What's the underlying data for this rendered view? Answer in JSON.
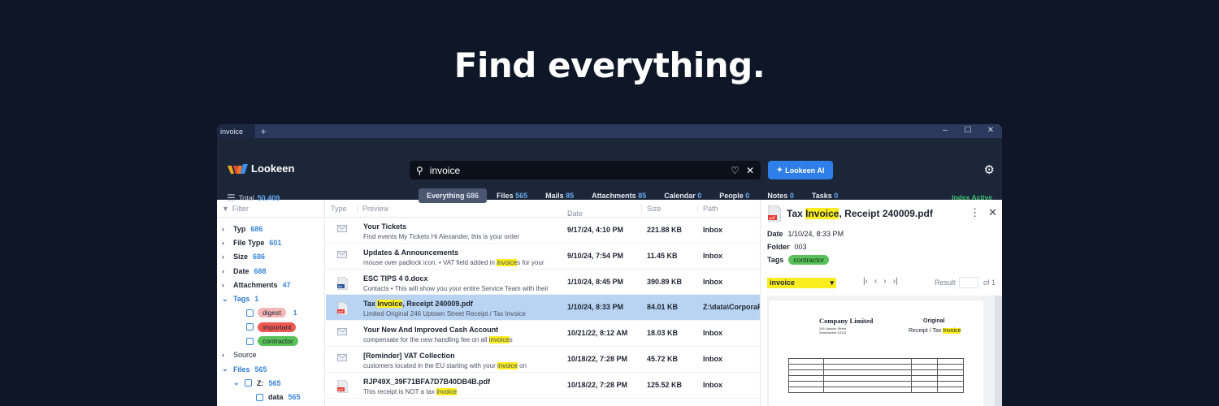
{
  "headline": "Find everything.",
  "window": {
    "tab_label": "invoice",
    "tab_add": "+",
    "controls": {
      "minimize": "–",
      "maximize": "☐",
      "close": "✕"
    }
  },
  "app": {
    "name": "Lookeen",
    "search": {
      "value": "invoice",
      "placeholder": ""
    },
    "ai_button": "Lookeen AI",
    "total_label": "Total",
    "total_count": "50,409",
    "index_status": "Index Active",
    "tabs": [
      {
        "label": "Everything",
        "count": "686"
      },
      {
        "label": "Files",
        "count": "565"
      },
      {
        "label": "Mails",
        "count": "85"
      },
      {
        "label": "Attachments",
        "count": "85"
      },
      {
        "label": "Calendar",
        "count": "0"
      },
      {
        "label": "People",
        "count": "0"
      },
      {
        "label": "Notes",
        "count": "0"
      },
      {
        "label": "Tasks",
        "count": "0"
      }
    ]
  },
  "filter": {
    "header": "Filter",
    "items": [
      {
        "label": "Typ",
        "count": "686"
      },
      {
        "label": "File Type",
        "count": "601"
      },
      {
        "label": "Size",
        "count": "686"
      },
      {
        "label": "Date",
        "count": "688"
      },
      {
        "label": "Attachments",
        "count": "47"
      }
    ],
    "tags": {
      "label": "Tags",
      "count": "1"
    },
    "tag_items": [
      {
        "label": "digest",
        "count": "1",
        "color": "#f4b6b6"
      },
      {
        "label": "important",
        "count": "",
        "color": "#ee5a52"
      },
      {
        "label": "contractor",
        "count": "",
        "color": "#5ac25a"
      }
    ],
    "source": "Source",
    "files": {
      "label": "Files",
      "count": "565"
    },
    "drive": {
      "label": "Z:",
      "count": "565"
    },
    "data_folder": {
      "label": "data",
      "count": "565"
    }
  },
  "list": {
    "columns": {
      "type": "Type",
      "preview": "Preview",
      "date": "Date",
      "size": "Size",
      "path": "Path"
    },
    "rows": [
      {
        "icon": "mail",
        "title_pre": "Your Tickets",
        "title_hl": "",
        "title_post": "",
        "snip_pre": "Find events My Tickets Hi Alexander, this is your order",
        "snip_hl": "",
        "snip_post": "",
        "date": "9/17/24, 4:10 PM",
        "size": "221.88 KB",
        "path": "Inbox"
      },
      {
        "icon": "mail",
        "title_pre": "Updates & Announcements",
        "title_hl": "",
        "title_post": "",
        "snip_pre": "mouse over padlock icon. • VAT field added in ",
        "snip_hl": "invoice",
        "snip_post": "s for your",
        "date": "9/10/24, 7:54 PM",
        "size": "11.45 KB",
        "path": "Inbox"
      },
      {
        "icon": "docx",
        "title_pre": "ESC TIPS 4 0.docx",
        "title_hl": "",
        "title_post": "",
        "snip_pre": "Contacts • This will show you your entire Service Team with their",
        "snip_hl": "",
        "snip_post": "",
        "date": "1/10/24, 8:45 PM",
        "size": "390.89 KB",
        "path": "Inbox"
      },
      {
        "icon": "pdf",
        "title_pre": "Tax ",
        "title_hl": "Invoice",
        "title_post": ", Receipt 240009.pdf",
        "snip_pre": "Limited Original 246 Uptown Street Receipt / Tax Invoice",
        "snip_hl": "",
        "snip_post": "",
        "date": "1/10/24, 8:33 PM",
        "size": "84.01 KB",
        "path": "Z:\\data\\CorporaFi"
      },
      {
        "icon": "mail",
        "title_pre": "Your New And Improved Cash Account",
        "title_hl": "",
        "title_post": "",
        "snip_pre": "compensate for the new handling fee on all ",
        "snip_hl": "invoice",
        "snip_post": "s",
        "date": "10/21/22, 8:12 AM",
        "size": "18.03 KB",
        "path": "Inbox"
      },
      {
        "icon": "mail",
        "title_pre": "[Reminder] VAT Collection",
        "title_hl": "",
        "title_post": "",
        "snip_pre": "customers located in the EU starting with your ",
        "snip_hl": "invoice",
        "snip_post": " on",
        "date": "10/18/22, 7:28 PM",
        "size": "45.72 KB",
        "path": "Inbox"
      },
      {
        "icon": "pdf",
        "title_pre": "RJP49X_39F71BFA7D7B40DB4B.pdf",
        "title_hl": "",
        "title_post": "",
        "snip_pre": "This receipt is NOT a tax ",
        "snip_hl": "invoice",
        "snip_post": "",
        "date": "10/18/22, 7:28 PM",
        "size": "125.52 KB",
        "path": "Inbox"
      }
    ]
  },
  "preview": {
    "title_pre": "Tax ",
    "title_hl": "Invoice",
    "title_post": ", Receipt 240009.pdf",
    "date_label": "Date",
    "date_value": "1/10/24, 8:33 PM",
    "folder_label": "Folder",
    "folder_value": "003",
    "tags_label": "Tags",
    "tag_value": "contractor",
    "find_select": "invoice",
    "result_label": "Result",
    "of_label": "of 1",
    "doc": {
      "company": "Company Limited",
      "address": "246 Uptown Street\nSomewhere 10113",
      "original": "Original",
      "receipt_pre": "Receipt / Tax ",
      "receipt_hl": "Invoice"
    }
  }
}
